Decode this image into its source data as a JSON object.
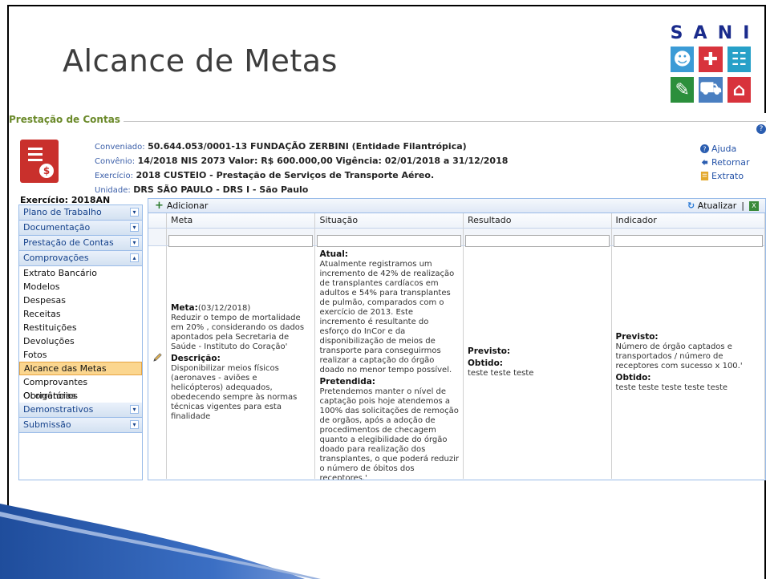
{
  "slide": {
    "title": "Alcance de Metas"
  },
  "logo": {
    "letters": [
      "S",
      "A",
      "N",
      "I"
    ],
    "colors": [
      "#3b9bd6",
      "#e37b2a",
      "#27a0c8",
      "#2b8f3c",
      "#4a7fc1",
      "#d8333c"
    ]
  },
  "fieldset": {
    "legend": "Prestação de Contas"
  },
  "info": {
    "conveniado_label": "Conveniado:",
    "conveniado_value": "50.644.053/0001-13  FUNDAÇÃO ZERBINI  (Entidade Filantrópica)",
    "convenio_label": "Convênio:",
    "convenio_value": "14/2018 NIS 2073 Valor: R$ 600.000,00 Vigência: 02/01/2018 a 31/12/2018",
    "exercicio_label": "Exercício:",
    "exercicio_value": "2018  CUSTEIO - Prestação de Serviços de Transporte Aéreo.",
    "unidade_label": "Unidade:",
    "unidade_value": "DRS SÃO PAULO - DRS I - São Paulo"
  },
  "links": {
    "ajuda": "Ajuda",
    "retornar": "Retornar",
    "extrato": "Extrato"
  },
  "exercicio_badge": "Exercício: 2018AN",
  "sidebar": {
    "plano": "Plano de Trabalho",
    "documentacao": "Documentação",
    "prestacao": "Prestação de Contas",
    "comprovacoes": "Comprovações",
    "items": [
      "Extrato Bancário",
      "Modelos",
      "Despesas",
      "Receitas",
      "Restituições",
      "Devoluções",
      "Fotos",
      "Alcance das Metas",
      "Comprovantes Obrigatórios",
      "Ocorrências"
    ],
    "demonstrativos": "Demonstrativos",
    "submissao": "Submissão"
  },
  "toolbar": {
    "add": "Adicionar",
    "refresh": "Atualizar",
    "sep": "|"
  },
  "columns": {
    "meta": "Meta",
    "situacao": "Situação",
    "resultado": "Resultado",
    "indicador": "Indicador"
  },
  "row": {
    "meta_label": "Meta:",
    "meta_date": "(03/12/2018)",
    "meta_text": "Reduzir o tempo de mortalidade em 20% , considerando os dados apontados pela Secretaria de Saúde - Instituto do Coração'",
    "desc_label": "Descrição:",
    "desc_text": "Disponibilizar meios físicos (aeronaves - aviões e helicópteros) adequados, obedecendo sempre às normas técnicas vigentes para esta finalidade",
    "atual_label": "Atual:",
    "atual_text": "Atualmente registramos um incremento de 42% de realização de transplantes cardíacos em adultos e 54% para transplantes de pulmão, comparados com o exercício de 2013. Este incremento é resultante do esforço do InCor e da disponibilização de meios de transporte para conseguirmos realizar a captação do órgão doado no menor tempo possível.",
    "pretendida_label": "Pretendida:",
    "pretendida_text": "Pretendemos manter o nível de captação pois hoje atendemos a 100% das solicitações de remoção de orgãos, após a adoção de procedimentos de checagem quanto a elegibilidade do órgão doado para realização dos transplantes, o que poderá reduzir o número de óbitos dos receptores.'",
    "res_previsto": "Previsto:",
    "res_obtido": "Obtido:",
    "res_obtido_text": "teste teste teste",
    "ind_previsto": "Previsto:",
    "ind_previsto_text": "Número de órgão captados e transportados / número de receptores com sucesso x 100.'",
    "ind_obtido": "Obtido:",
    "ind_obtido_text": "teste teste teste teste teste"
  }
}
